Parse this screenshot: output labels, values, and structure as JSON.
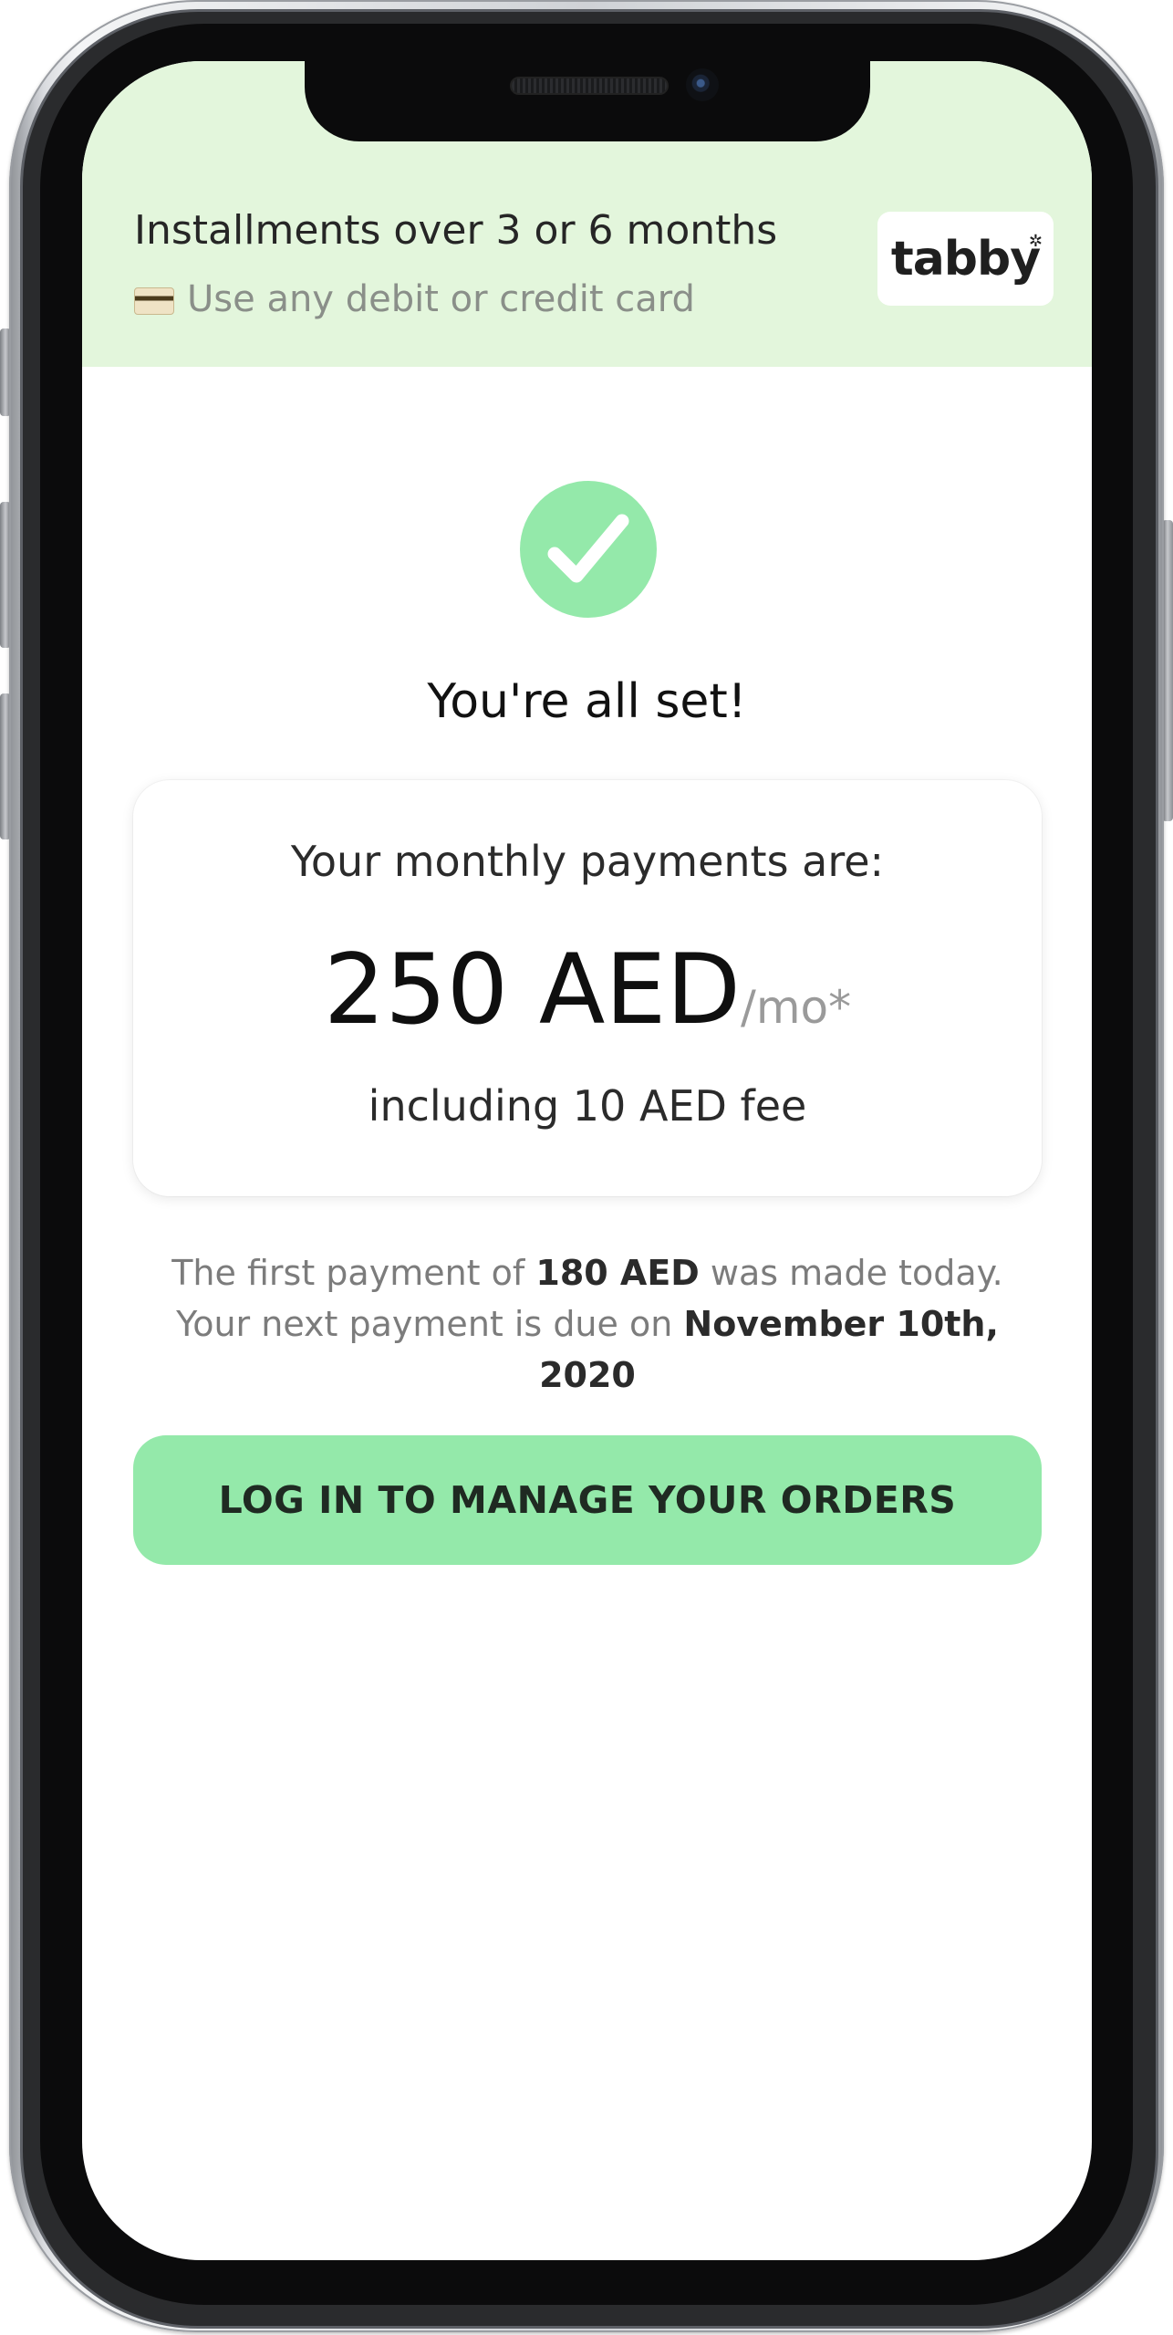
{
  "banner": {
    "title": "Installments over 3 or 6 months",
    "subtitle": "Use any debit or credit card",
    "card_icon": "credit-card-icon",
    "logo_text": "tabby",
    "logo_mark": "✲"
  },
  "success": {
    "icon": "check-icon",
    "heading": "You're all set!"
  },
  "payment_card": {
    "label": "Your monthly payments are:",
    "amount": "250 AED",
    "suffix": "/mo*",
    "fee": "including 10 AED fee"
  },
  "note": {
    "part1": "The first payment of ",
    "first_amount": "180 AED",
    "part2": " was made today. Your next payment is due on ",
    "due_date": "November 10th, 2020"
  },
  "cta": {
    "label": "LOG IN TO MANAGE YOUR ORDERS"
  },
  "colors": {
    "banner_bg": "#e3f6dc",
    "accent_green": "#94e9aa",
    "text_dark": "#111111",
    "text_muted": "#7c7c7c"
  }
}
